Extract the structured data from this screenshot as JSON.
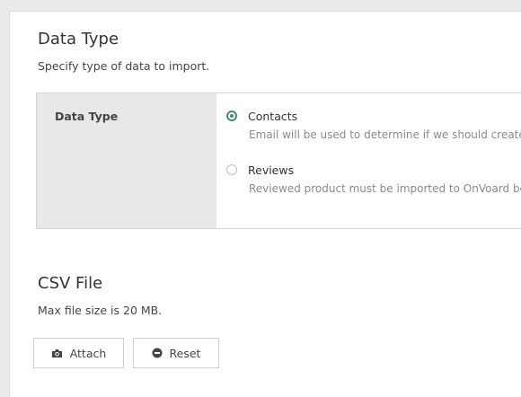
{
  "data_type_section": {
    "title": "Data Type",
    "subtitle": "Specify type of data to import.",
    "field_label": "Data Type",
    "options": [
      {
        "label": "Contacts",
        "description": "Email will be used to determine if we should create",
        "selected": true
      },
      {
        "label": "Reviews",
        "description": "Reviewed product must be imported to OnVoard be",
        "selected": false
      }
    ]
  },
  "csv_section": {
    "title": "CSV File",
    "subtitle": "Max file size is 20 MB.",
    "attach_label": "Attach",
    "attach_icon": "camera-icon",
    "reset_label": "Reset",
    "reset_icon": "minus-circle-icon"
  },
  "colors": {
    "accent": "#3c8f6e",
    "panel_bg": "#ffffff",
    "page_bg": "#ebebeb",
    "label_col_bg": "#e8e8e8"
  }
}
